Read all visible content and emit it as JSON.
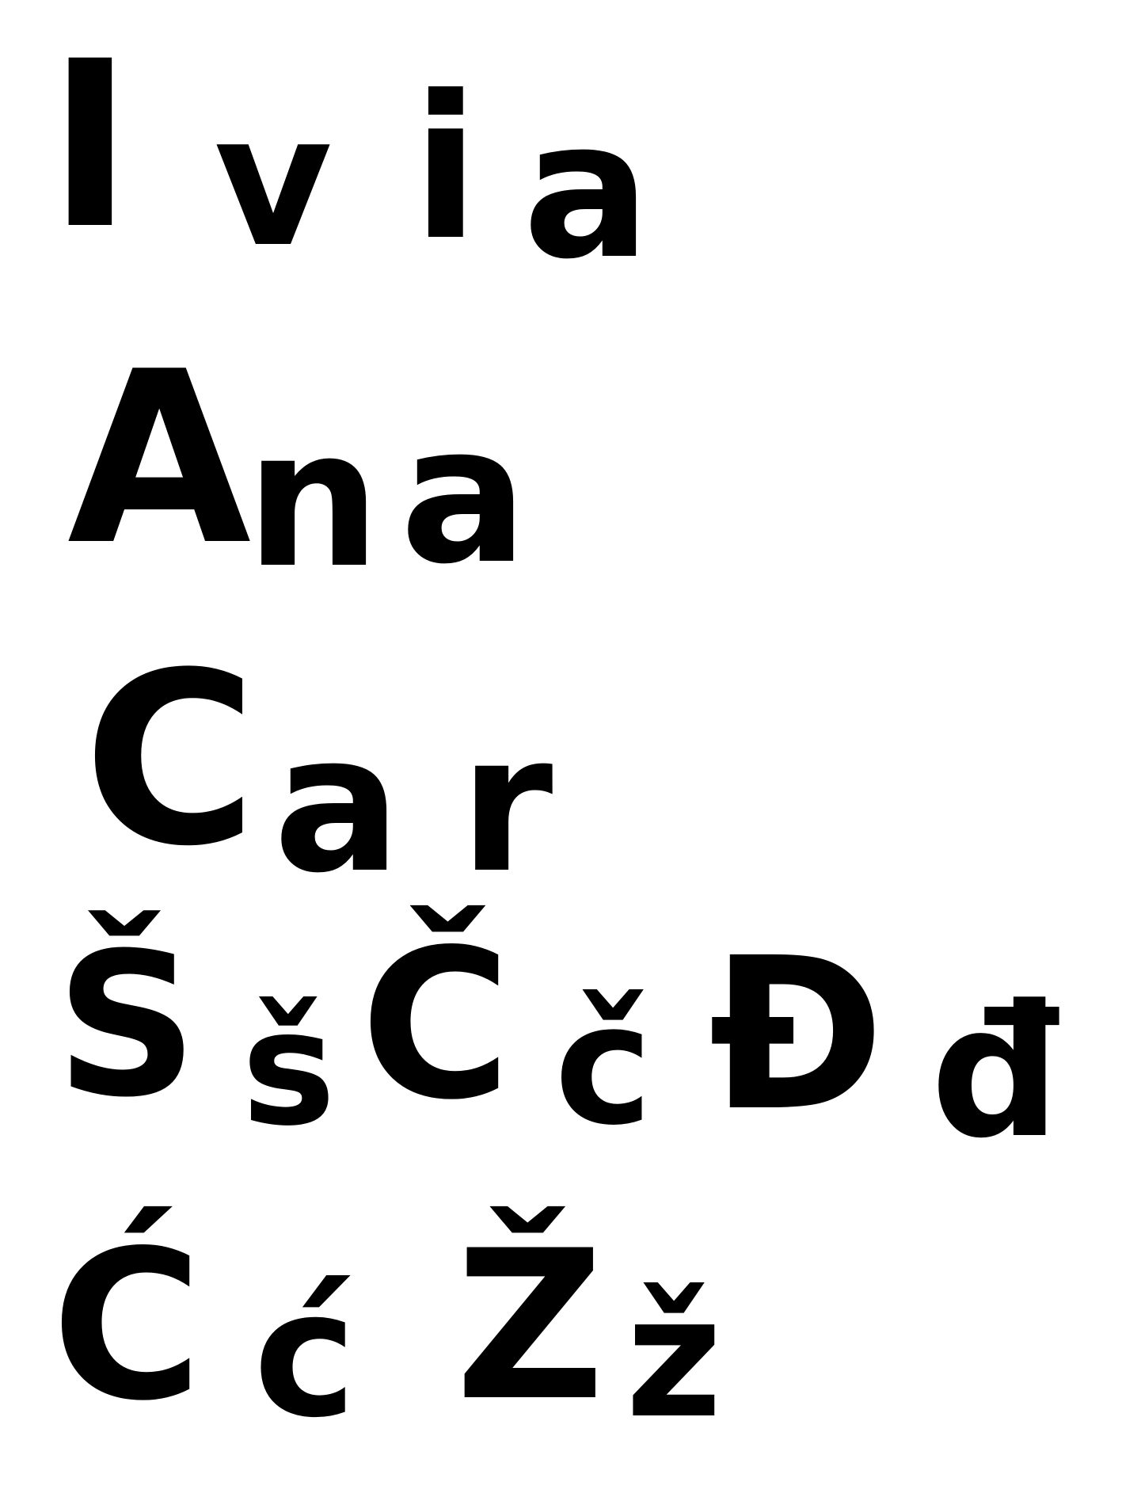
{
  "sheet": {
    "background": "#ffffff",
    "ink": "#000000",
    "rows": [
      {
        "glyphs": [
          "I",
          "v",
          "i",
          "a"
        ]
      },
      {
        "glyphs": [
          "A",
          "n",
          "a"
        ]
      },
      {
        "glyphs": [
          "C",
          "a",
          "r"
        ]
      },
      {
        "glyphs": [
          "Š",
          "š",
          "Č",
          "č",
          "Đ",
          "đ"
        ]
      },
      {
        "glyphs": [
          "Ć",
          "ć",
          "Ž",
          "ž"
        ]
      }
    ]
  }
}
